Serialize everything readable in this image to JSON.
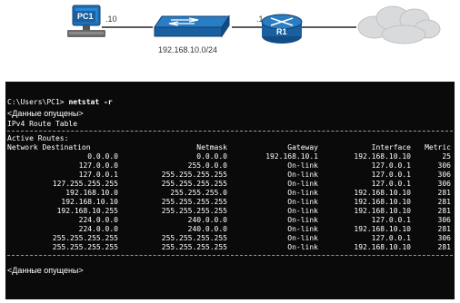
{
  "topology": {
    "pc_label": "PC1",
    "pc_host": ".10",
    "network": "192.168.10.0/24",
    "router_host": ".1",
    "router_label": "R1"
  },
  "terminal": {
    "prompt": "C:\\Users\\PC1>",
    "command": "netstat -r",
    "omitted": "<Данные опущены>",
    "table_title": "IPv4 Route Table",
    "active_routes": "Active Routes:",
    "columns": [
      "Network Destination",
      "Netmask",
      "Gateway",
      "Interface",
      "Metric"
    ],
    "rows": [
      [
        "0.0.0.0",
        "0.0.0.0",
        "192.168.10.1",
        "192.168.10.10",
        "25"
      ],
      [
        "127.0.0.0",
        "255.0.0.0",
        "On-link",
        "127.0.0.1",
        "306"
      ],
      [
        "127.0.0.1",
        "255.255.255.255",
        "On-link",
        "127.0.0.1",
        "306"
      ],
      [
        "127.255.255.255",
        "255.255.255.255",
        "On-link",
        "127.0.0.1",
        "306"
      ],
      [
        "192.168.10.0",
        "255.255.255.0",
        "On-link",
        "192.168.10.10",
        "281"
      ],
      [
        "192.168.10.10",
        "255.255.255.255",
        "On-link",
        "192.168.10.10",
        "281"
      ],
      [
        "192.168.10.255",
        "255.255.255.255",
        "On-link",
        "192.168.10.10",
        "281"
      ],
      [
        "224.0.0.0",
        "240.0.0.0",
        "On-link",
        "127.0.0.1",
        "306"
      ],
      [
        "224.0.0.0",
        "240.0.0.0",
        "On-link",
        "192.168.10.10",
        "281"
      ],
      [
        "255.255.255.255",
        "255.255.255.255",
        "On-link",
        "127.0.0.1",
        "306"
      ],
      [
        "255.255.255.255",
        "255.255.255.255",
        "On-link",
        "192.168.10.10",
        "281"
      ]
    ]
  },
  "colors": {
    "device_blue": "#1f6fb5",
    "terminal_bg": "#0a0a0a",
    "cloud": "#d8dadc"
  }
}
